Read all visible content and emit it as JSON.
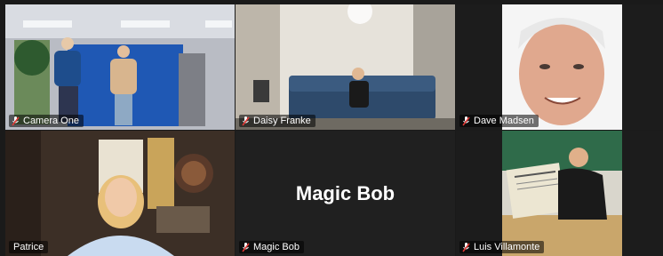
{
  "participants": [
    {
      "name": "Camera One",
      "muted": true,
      "active": true
    },
    {
      "name": "Daisy Franke",
      "muted": true,
      "active": false
    },
    {
      "name": "Dave Madsen",
      "muted": true,
      "active": false
    },
    {
      "name": "Patrice",
      "muted": false,
      "active": false
    },
    {
      "name": "Magic Bob",
      "muted": true,
      "active": false,
      "video_off_label": "Magic Bob"
    },
    {
      "name": "Luis Villamonte",
      "muted": true,
      "active": false
    }
  ],
  "colors": {
    "active_border": "#8bc34a",
    "muted_icon": "#e53935",
    "background": "#1a1a1a"
  },
  "icons": {
    "muted": "mic-muted-icon"
  }
}
